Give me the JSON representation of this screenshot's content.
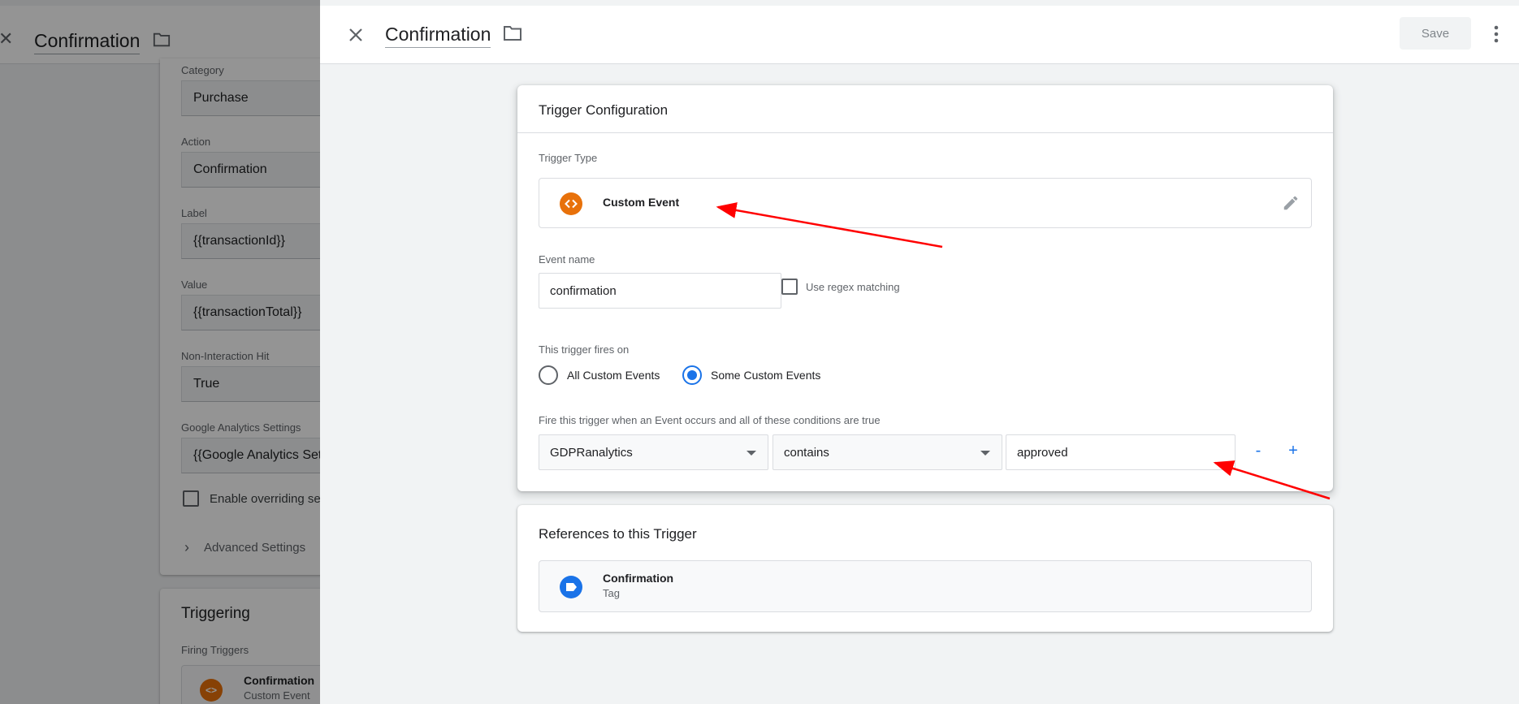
{
  "background_panel": {
    "title": "Confirmation",
    "fields": [
      {
        "label": "Category",
        "value": "Purchase"
      },
      {
        "label": "Action",
        "value": "Confirmation"
      },
      {
        "label": "Label",
        "value": "{{transactionId}}"
      },
      {
        "label": "Value",
        "value": "{{transactionTotal}}"
      },
      {
        "label": "Non-Interaction Hit",
        "value": "True"
      },
      {
        "label": "Google Analytics Settings",
        "value": "{{Google Analytics Sett"
      }
    ],
    "override_label": "Enable overriding sett",
    "advanced_label": "Advanced Settings",
    "triggering": {
      "title": "Triggering",
      "firing_label": "Firing Triggers",
      "item_icon_text": "<>",
      "item_name": "Confirmation",
      "item_sub": "Custom Event"
    }
  },
  "header": {
    "title": "Confirmation",
    "save_label": "Save"
  },
  "trigger_config": {
    "title": "Trigger Configuration",
    "type_label": "Trigger Type",
    "type_name": "Custom Event",
    "event_name_label": "Event name",
    "event_name_value": "confirmation",
    "regex_label": "Use regex matching",
    "fires_on_label": "This trigger fires on",
    "option_all": "All Custom Events",
    "option_some": "Some Custom Events",
    "selected_option": "Some Custom Events",
    "condition_label": "Fire this trigger when an Event occurs and all of these conditions are true",
    "condition": {
      "variable": "GDPRanalytics",
      "operator": "contains",
      "value": "approved"
    },
    "remove_label": "-",
    "add_label": "+"
  },
  "references": {
    "title": "References to this Trigger",
    "item_name": "Confirmation",
    "item_type": "Tag"
  },
  "colors": {
    "accent": "#1a73e8",
    "custom_event_icon": "#e8710a",
    "annotation_arrow": "#ff0000"
  }
}
